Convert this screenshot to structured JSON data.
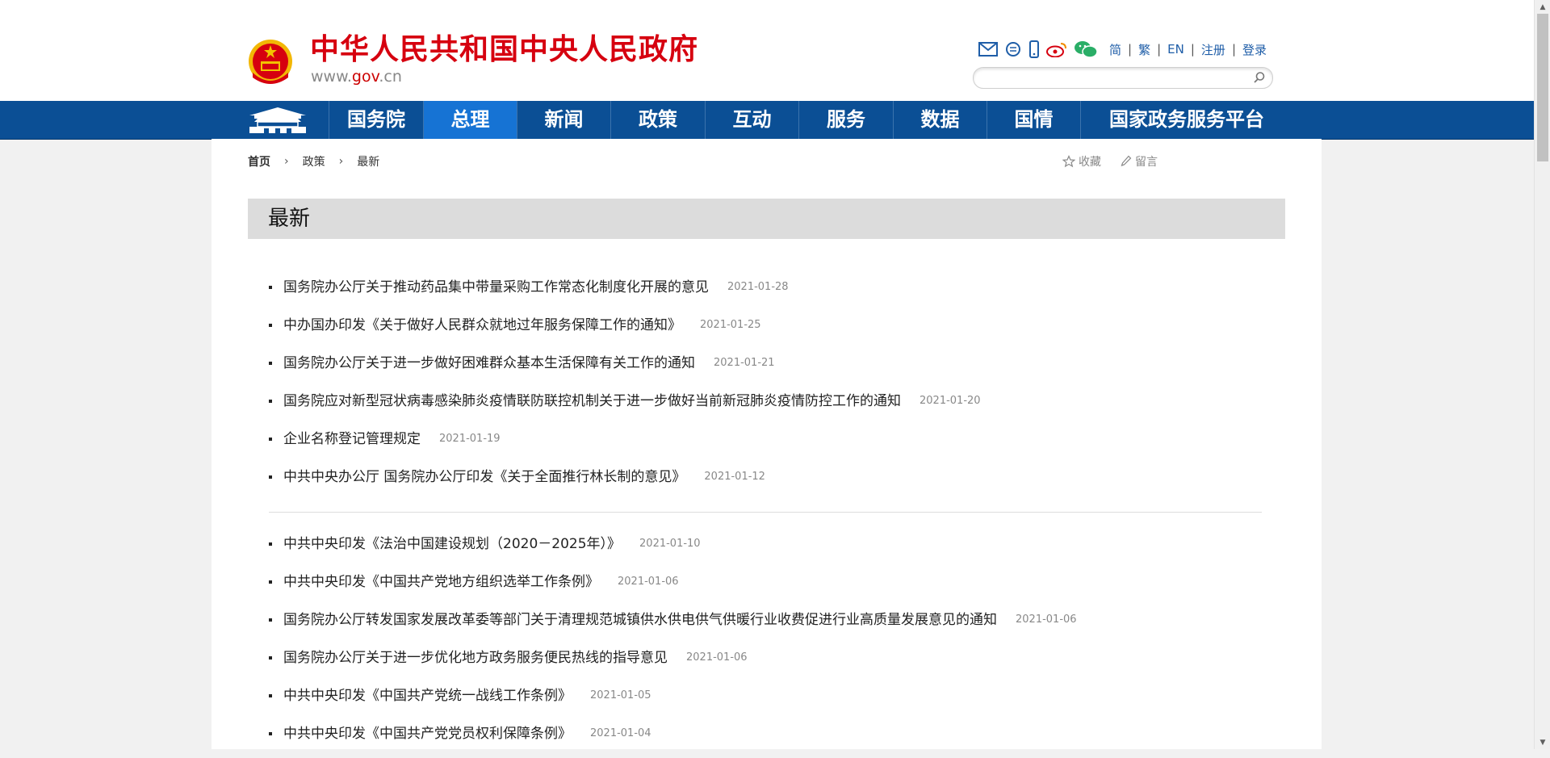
{
  "header": {
    "site_title": "中华人民共和国中央人民政府",
    "site_domain_prefix": "www.",
    "site_domain_main": "gov",
    "site_domain_suffix": ".cn",
    "icons": [
      "mail-icon",
      "message-icon",
      "mobile-icon",
      "weibo-icon",
      "wechat-icon"
    ],
    "links": [
      "简",
      "繁",
      "EN",
      "注册",
      "登录"
    ],
    "search": {
      "value": "",
      "placeholder": ""
    },
    "brand_red": "#d6000f",
    "link_blue": "#1f5ea8"
  },
  "nav": {
    "items": [
      "国务院",
      "总理",
      "新闻",
      "政策",
      "互动",
      "服务",
      "数据",
      "国情",
      "国家政务服务平台"
    ],
    "active": "总理",
    "bar_color": "#0b4f95",
    "active_color": "#1673d4"
  },
  "breadcrumb": [
    "首页",
    "政策",
    "最新"
  ],
  "tools": {
    "favorite": "收藏",
    "message": "留言"
  },
  "section": {
    "title": "最新"
  },
  "news_group_1": [
    {
      "title": "国务院办公厅关于推动药品集中带量采购工作常态化制度化开展的意见",
      "date": "2021-01-28"
    },
    {
      "title": "中办国办印发《关于做好人民群众就地过年服务保障工作的通知》",
      "date": "2021-01-25"
    },
    {
      "title": "国务院办公厅关于进一步做好困难群众基本生活保障有关工作的通知",
      "date": "2021-01-21"
    },
    {
      "title": "国务院应对新型冠状病毒感染肺炎疫情联防联控机制关于进一步做好当前新冠肺炎疫情防控工作的通知",
      "date": "2021-01-20"
    },
    {
      "title": "企业名称登记管理规定",
      "date": "2021-01-19"
    },
    {
      "title": "中共中央办公厅 国务院办公厅印发《关于全面推行林长制的意见》",
      "date": "2021-01-12"
    }
  ],
  "news_group_2": [
    {
      "title": "中共中央印发《法治中国建设规划（2020－2025年）》",
      "date": "2021-01-10"
    },
    {
      "title": "中共中央印发《中国共产党地方组织选举工作条例》",
      "date": "2021-01-06"
    },
    {
      "title": "国务院办公厅转发国家发展改革委等部门关于清理规范城镇供水供电供气供暖行业收费促进行业高质量发展意见的通知",
      "date": "2021-01-06"
    },
    {
      "title": "国务院办公厅关于进一步优化地方政务服务便民热线的指导意见",
      "date": "2021-01-06"
    },
    {
      "title": "中共中央印发《中国共产党统一战线工作条例》",
      "date": "2021-01-05"
    },
    {
      "title": "中共中央印发《中国共产党党员权利保障条例》",
      "date": "2021-01-04"
    }
  ]
}
